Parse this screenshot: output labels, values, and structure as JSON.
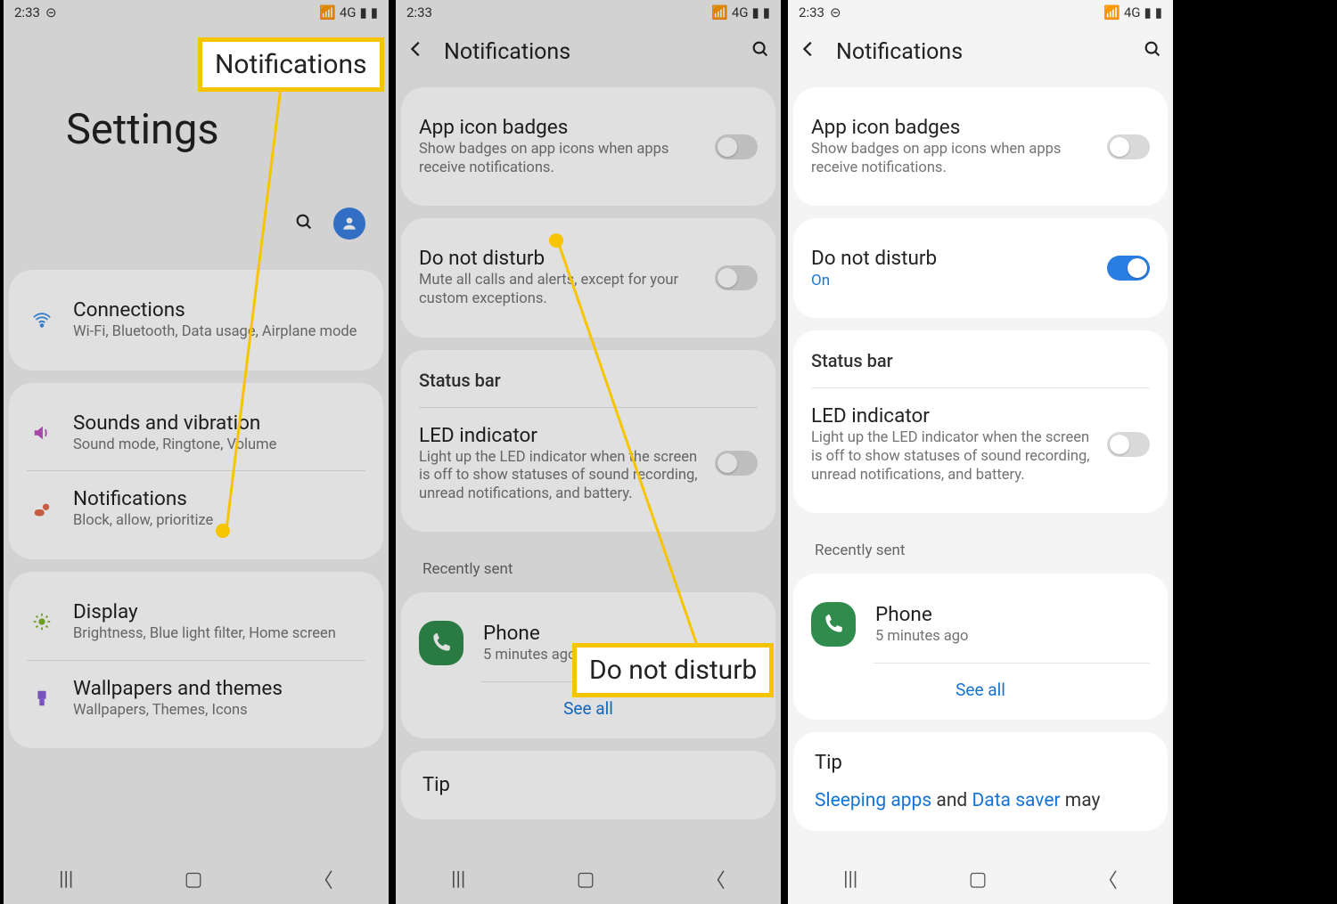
{
  "status": {
    "time": "2:33",
    "dnd": "⊝",
    "net": "4G",
    "sig": "▮▯",
    "bat": "■"
  },
  "s1": {
    "title": "Settings",
    "callout": "Notifications",
    "items": [
      {
        "title": "Connections",
        "sub": "Wi-Fi, Bluetooth, Data usage, Airplane mode",
        "icon": "wifi",
        "color": "#3a8fe6"
      },
      {
        "title": "Sounds and vibration",
        "sub": "Sound mode, Ringtone, Volume",
        "icon": "sound",
        "color": "#c04fc0"
      },
      {
        "title": "Notifications",
        "sub": "Block, allow, prioritize",
        "icon": "notif",
        "color": "#e06a4f"
      },
      {
        "title": "Display",
        "sub": "Brightness, Blue light filter, Home screen",
        "icon": "sun",
        "color": "#7db32a"
      },
      {
        "title": "Wallpapers and themes",
        "sub": "Wallpapers, Themes, Icons",
        "icon": "brush",
        "color": "#8a5fd6"
      }
    ]
  },
  "s2": {
    "header": "Notifications",
    "callout": "Do not disturb",
    "badges": {
      "title": "App icon badges",
      "sub": "Show badges on app icons when apps receive notifications."
    },
    "dnd": {
      "title": "Do not disturb",
      "sub": "Mute all calls and alerts, except for your custom exceptions."
    },
    "statusbar": "Status bar",
    "led": {
      "title": "LED indicator",
      "sub": "Light up the LED indicator when the screen is off to show statuses of sound recording, unread notifications, and battery."
    },
    "recent_label": "Recently sent",
    "recent": {
      "app": "Phone",
      "time": "5 minutes ago"
    },
    "see_all": "See all",
    "tip": "Tip"
  },
  "s3": {
    "header": "Notifications",
    "badges": {
      "title": "App icon badges",
      "sub": "Show badges on app icons when apps receive notifications."
    },
    "dnd": {
      "title": "Do not disturb",
      "on": "On"
    },
    "statusbar": "Status bar",
    "led": {
      "title": "LED indicator",
      "sub": "Light up the LED indicator when the screen is off to show statuses of sound recording, unread notifications, and battery."
    },
    "recent_label": "Recently sent",
    "recent": {
      "app": "Phone",
      "time": "5 minutes ago"
    },
    "see_all": "See all",
    "tip": "Tip",
    "tip_body_pre": "",
    "sleeping": "Sleeping apps",
    "and": " and ",
    "datasaver": "Data saver",
    "may": " may"
  }
}
